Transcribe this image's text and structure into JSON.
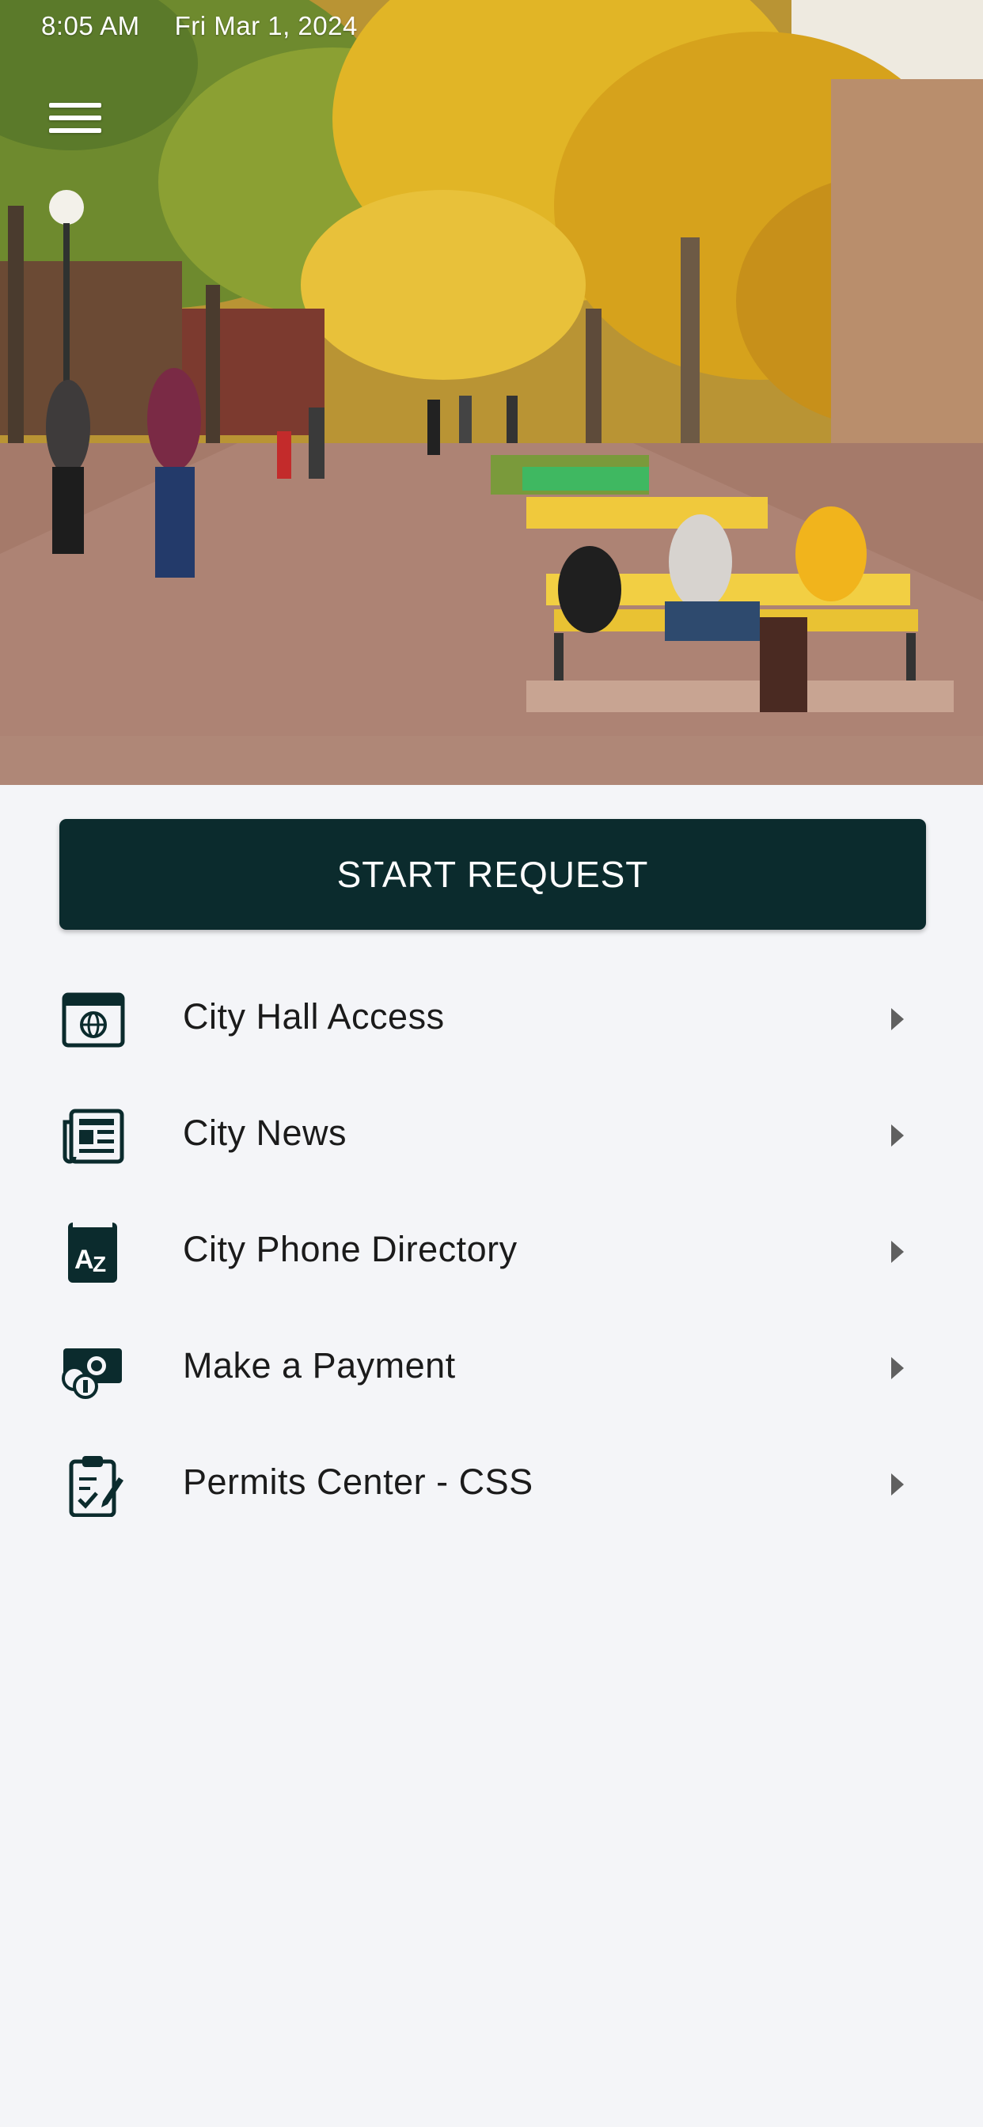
{
  "status_bar": {
    "time": "8:05 AM",
    "date": "Fri Mar 1, 2024"
  },
  "header": {
    "menu_icon": "hamburger-menu-icon"
  },
  "actions": {
    "start_request_label": "START REQUEST"
  },
  "menu": {
    "items": [
      {
        "label": "City Hall Access",
        "icon": "globe-browser-icon"
      },
      {
        "label": "City News",
        "icon": "newspaper-icon"
      },
      {
        "label": "City Phone Directory",
        "icon": "a-z-directory-icon"
      },
      {
        "label": "Make a Payment",
        "icon": "money-coins-icon"
      },
      {
        "label": "Permits Center - CSS",
        "icon": "clipboard-check-icon"
      }
    ]
  },
  "colors": {
    "primary_button": "#0b2b2d",
    "background": "#f4f5f8",
    "text": "#1b1b1b",
    "chevron": "#606060"
  }
}
